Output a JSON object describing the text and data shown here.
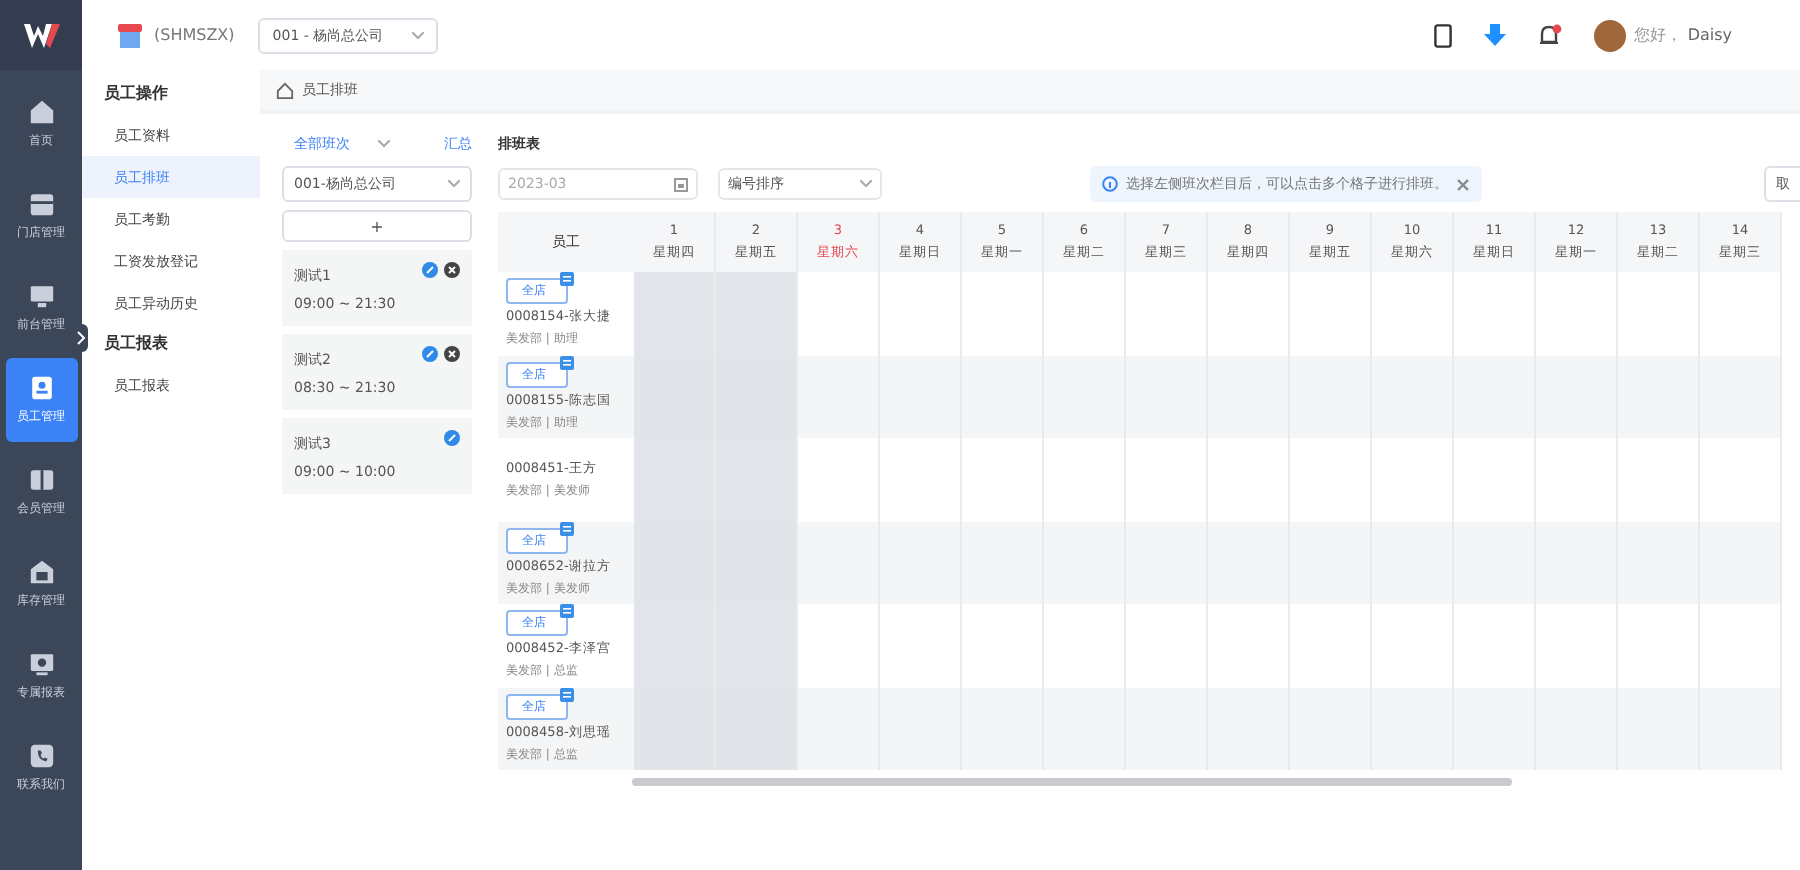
{
  "header": {
    "store_name": "(SHMSZX)",
    "company": "001 - 杨尚总公司",
    "greeting": "您好，",
    "user": "Daisy"
  },
  "sidebar": {
    "items": [
      {
        "label": "首页",
        "selected": false
      },
      {
        "label": "门店管理",
        "selected": false
      },
      {
        "label": "前台管理",
        "selected": false
      },
      {
        "label": "员工管理",
        "selected": true
      },
      {
        "label": "会员管理",
        "selected": false
      },
      {
        "label": "库存管理",
        "selected": false
      },
      {
        "label": "专属报表",
        "selected": false
      },
      {
        "label": "联系我们",
        "selected": false
      }
    ]
  },
  "submenu": {
    "groups": [
      {
        "title": "员工操作",
        "items": [
          {
            "label": "员工资料",
            "selected": false
          },
          {
            "label": "员工排班",
            "selected": true
          },
          {
            "label": "员工考勤",
            "selected": false
          },
          {
            "label": "工资发放登记",
            "selected": false
          },
          {
            "label": "员工异动历史",
            "selected": false
          }
        ]
      },
      {
        "title": "员工报表",
        "items": [
          {
            "label": "员工报表",
            "selected": false
          }
        ]
      }
    ]
  },
  "breadcrumb": "员工排班",
  "shifts": {
    "filter": "全部班次",
    "summary_link": "汇总",
    "store": "001-杨尚总公司",
    "add_button": "+",
    "items": [
      {
        "name": "测试1",
        "time": "09:00 ~ 21:30",
        "delete_visible": true
      },
      {
        "name": "测试2",
        "time": "08:30 ~ 21:30",
        "delete_visible": true
      },
      {
        "name": "测试3",
        "time": "09:00 ~ 10:00",
        "delete_visible": false
      }
    ]
  },
  "schedule": {
    "title": "排班表",
    "month": "2023-03",
    "sort": "编号排序",
    "notice": "选择左侧班次栏目后，可以点击多个格子进行排班。",
    "action_button": "取",
    "employee_header": "员工",
    "days": [
      {
        "date": "1",
        "weekday": "星期四",
        "past": true,
        "today": false
      },
      {
        "date": "2",
        "weekday": "星期五",
        "past": true,
        "today": false
      },
      {
        "date": "3",
        "weekday": "星期六",
        "past": false,
        "today": true
      },
      {
        "date": "4",
        "weekday": "星期日",
        "past": false,
        "today": false
      },
      {
        "date": "5",
        "weekday": "星期一",
        "past": false,
        "today": false
      },
      {
        "date": "6",
        "weekday": "星期二",
        "past": false,
        "today": false
      },
      {
        "date": "7",
        "weekday": "星期三",
        "past": false,
        "today": false
      },
      {
        "date": "8",
        "weekday": "星期四",
        "past": false,
        "today": false
      },
      {
        "date": "9",
        "weekday": "星期五",
        "past": false,
        "today": false
      },
      {
        "date": "10",
        "weekday": "星期六",
        "past": false,
        "today": false
      },
      {
        "date": "11",
        "weekday": "星期日",
        "past": false,
        "today": false
      },
      {
        "date": "12",
        "weekday": "星期一",
        "past": false,
        "today": false
      },
      {
        "date": "13",
        "weekday": "星期二",
        "past": false,
        "today": false
      },
      {
        "date": "14",
        "weekday": "星期三",
        "past": false,
        "today": false
      }
    ],
    "employees": [
      {
        "tag": "全店",
        "name": "0008154-张大捷",
        "role": "美发部 | 助理"
      },
      {
        "tag": "全店",
        "name": "0008155-陈志国",
        "role": "美发部 | 助理"
      },
      {
        "name": "0008451-王方",
        "role": "美发部 | 美发师"
      },
      {
        "tag": "全店",
        "name": "0008652-谢拉方",
        "role": "美发部 | 美发师"
      },
      {
        "tag": "全店",
        "name": "0008452-李泽宫",
        "role": "美发部 | 总监"
      },
      {
        "tag": "全店",
        "name": "0008458-刘思瑶",
        "role": "美发部 | 总监"
      }
    ]
  }
}
